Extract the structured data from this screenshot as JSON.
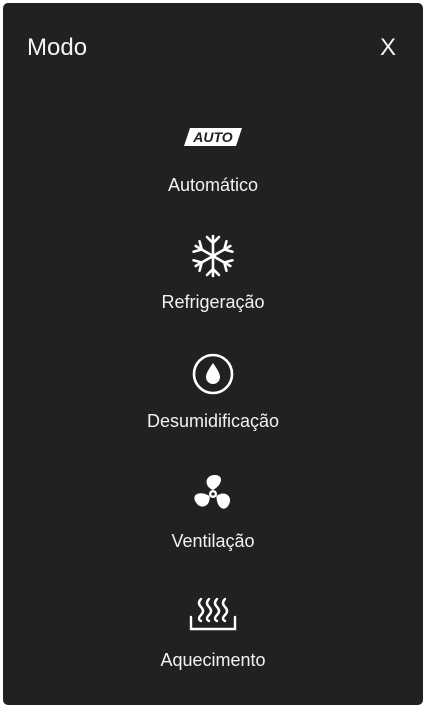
{
  "header": {
    "title": "Modo",
    "close_label": "X"
  },
  "modes": [
    {
      "label": "Automático",
      "icon": "auto-icon",
      "badge_text": "AUTO"
    },
    {
      "label": "Refrigeração",
      "icon": "snowflake-icon"
    },
    {
      "label": "Desumidificação",
      "icon": "water-drop-icon"
    },
    {
      "label": "Ventilação",
      "icon": "fan-icon"
    },
    {
      "label": "Aquecimento",
      "icon": "heat-waves-icon"
    }
  ],
  "colors": {
    "background": "#212121",
    "text": "#f2f2f2"
  }
}
